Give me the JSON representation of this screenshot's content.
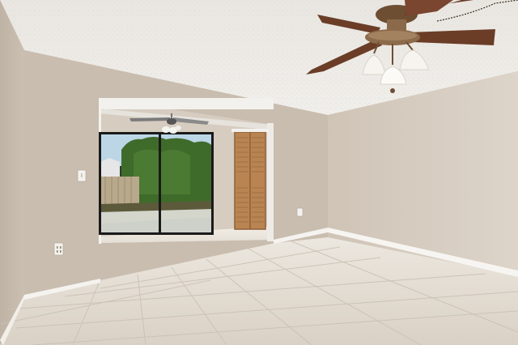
{
  "scene": {
    "kind": "photo",
    "subject": "empty room",
    "colors": {
      "ceiling": "#ece9e4",
      "wall_left": "#cfc4b7",
      "wall_back": "#c8bcae",
      "wall_right": "#d6ccc1",
      "floor": "#e3ddd3",
      "baseboard": "#f4f2ee",
      "fan_blade": "#6b3d27",
      "fan_metal": "#8a6a4a",
      "closet_door": "#b98452",
      "foliage": "#3f6b2a",
      "sky": "#bcd6e6",
      "fence": "#b9a98c"
    },
    "objects": [
      "ceiling-fan-icon",
      "ceiling-fan-small-icon",
      "sliding-glass-door",
      "closet-door",
      "light-switch-icon",
      "outlet-icon",
      "tile-floor",
      "baseboard"
    ]
  }
}
